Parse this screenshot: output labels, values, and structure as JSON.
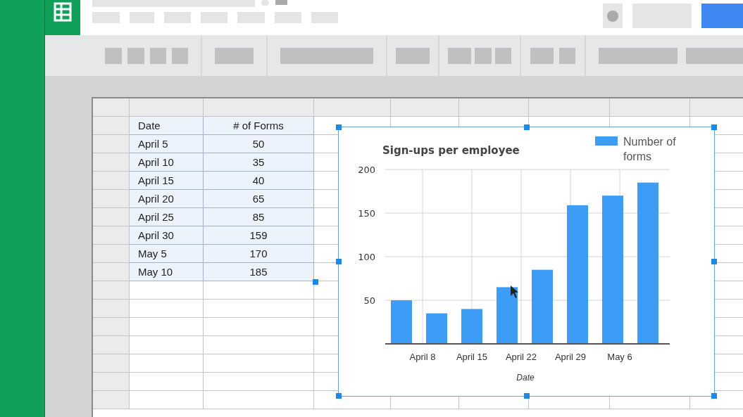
{
  "sheet": {
    "range_selected": true,
    "columns": [
      "Date",
      "# of Forms"
    ],
    "rows": [
      [
        "April 5",
        "50"
      ],
      [
        "April 10",
        "35"
      ],
      [
        "April 15",
        "40"
      ],
      [
        "April 20",
        "65"
      ],
      [
        "April 25",
        "85"
      ],
      [
        "April 30",
        "159"
      ],
      [
        "May 5",
        "170"
      ],
      [
        "May 10",
        "185"
      ]
    ]
  },
  "chart": {
    "selected": true,
    "chart_data": {
      "type": "bar",
      "title": "Sign-ups per employee",
      "xlabel": "Date",
      "categories": [
        null,
        null,
        null,
        null,
        null,
        null,
        null,
        null
      ],
      "series": [
        {
          "name": "Number of forms",
          "color": "#3d9cf6",
          "values": [
            50,
            35,
            40,
            65,
            85,
            159,
            170,
            185
          ]
        }
      ],
      "ylim": [
        0,
        200
      ],
      "grid": true,
      "yticks": [
        50,
        100,
        150,
        200
      ]
    },
    "date_axis_labels": [
      "April 8",
      "April 15",
      "April 22",
      "April 29",
      "May 6"
    ]
  }
}
